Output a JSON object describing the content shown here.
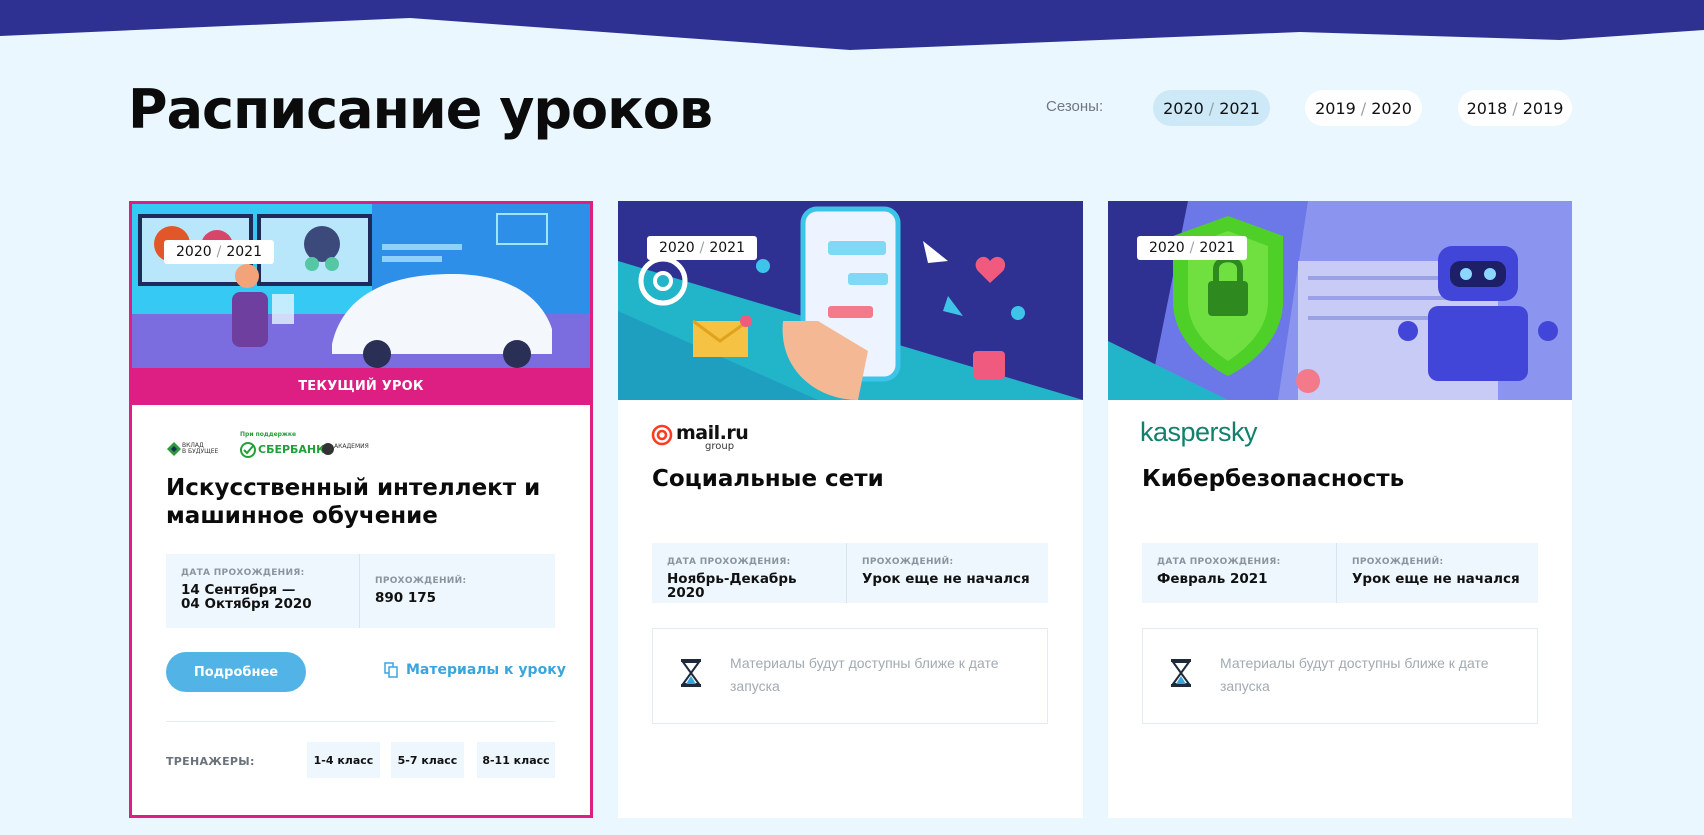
{
  "page": {
    "title": "Расписание уроков"
  },
  "seasons": {
    "label": "Сезоны:",
    "items": [
      {
        "from": "2020",
        "to": "2021",
        "active": true
      },
      {
        "from": "2019",
        "to": "2020",
        "active": false
      },
      {
        "from": "2018",
        "to": "2019",
        "active": false
      }
    ]
  },
  "cards": [
    {
      "season_from": "2020",
      "season_to": "2021",
      "current_label": "ТЕКУЩИЙ УРОК",
      "sponsors": {
        "support_note": "При поддержке",
        "sber": "СБЕРБАНК",
        "vklad_line1": "ВКЛАД",
        "vklad_line2": "В БУДУЩЕЕ",
        "academy": "АКАДЕМИЯ"
      },
      "title": "Искусственный интеллект и машинное обучение",
      "date_label": "ДАТА ПРОХОЖДЕНИЯ:",
      "date_line1": "14 Сентября —",
      "date_line2": "04 Октября 2020",
      "passes_label": "ПРОХОЖДЕНИЙ:",
      "passes_value": "890 175",
      "more_button": "Подробнее",
      "materials_link": "Материалы к уроку",
      "trainers_label": "ТРЕНАЖЕРЫ:",
      "grades": [
        "1-4 класс",
        "5-7 класс",
        "8-11 класс"
      ]
    },
    {
      "season_from": "2020",
      "season_to": "2021",
      "logo_text": "mail.ru",
      "logo_sub": "group",
      "title": "Социальные сети",
      "date_label": "ДАТА ПРОХОЖДЕНИЯ:",
      "date_value": "Ноябрь-Декабрь 2020",
      "passes_label": "ПРОХОЖДЕНИЙ:",
      "passes_value": "Урок еще не начался",
      "materials_note": "Материалы будут доступны ближе к дате запуска"
    },
    {
      "season_from": "2020",
      "season_to": "2021",
      "logo_text": "kaspersky",
      "title": "Кибербезопасность",
      "date_label": "ДАТА ПРОХОЖДЕНИЯ:",
      "date_value": "Февраль 2021",
      "passes_label": "ПРОХОЖДЕНИЙ:",
      "passes_value": "Урок еще не начался",
      "materials_note": "Материалы будут доступны ближе к дате запуска"
    }
  ],
  "colors": {
    "header_band": "#2e3192",
    "accent_pink": "#dd1e82",
    "button_blue": "#52b3e6",
    "link_blue": "#3aa5dd",
    "kaspersky_green": "#12806d",
    "background": "#eaf7fe"
  },
  "icons": {
    "copy": "copy-icon",
    "hourglass": "hourglass-icon",
    "at": "at-sign-icon"
  }
}
